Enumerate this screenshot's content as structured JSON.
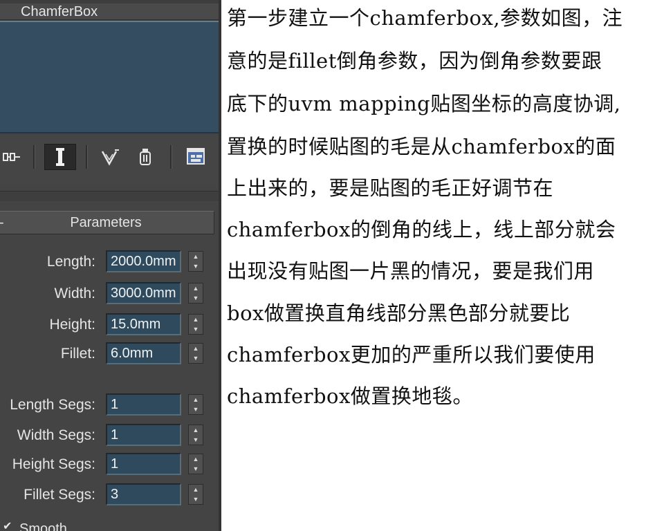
{
  "panel": {
    "object_name": "ChamferBox",
    "toolbar": {
      "icons": [
        "pin-stack-icon",
        "show-end-result-icon",
        "make-unique-icon",
        "remove-modifier-icon",
        "configure-modifier-sets-icon"
      ]
    },
    "rollout": {
      "toggle": "-",
      "title": "Parameters"
    },
    "params": [
      {
        "label": "Length:",
        "value": "2000.0mm"
      },
      {
        "label": "Width:",
        "value": "3000.0mm"
      },
      {
        "label": "Height:",
        "value": "15.0mm"
      },
      {
        "label": "Fillet:",
        "value": "6.0mm"
      }
    ],
    "segs": [
      {
        "label": "Length Segs:",
        "value": "1"
      },
      {
        "label": "Width Segs:",
        "value": "1"
      },
      {
        "label": "Height Segs:",
        "value": "1"
      },
      {
        "label": "Fillet Segs:",
        "value": "3"
      }
    ],
    "smooth": {
      "label": "Smooth",
      "checked": true
    }
  },
  "article": {
    "lines": [
      "第一步建立一个chamferbox,参数如图，注",
      "意的是fillet倒角参数，因为倒角参数要跟",
      "底下的uvm mapping贴图坐标的高度协调,",
      "置换的时候贴图的毛是从chamferbox的面",
      "上出来的，要是贴图的毛正好调节在",
      "chamferbox的倒角的线上，线上部分就会",
      "出现没有贴图一片黑的情况，要是我们用",
      "box做置换直角线部分黑色部分就要比",
      "chamferbox更加的严重所以我们要使用",
      "chamferbox做置换地毯。"
    ]
  },
  "colors": {
    "panel_bg": "#444444",
    "viewport": "#344d60",
    "field_bg": "#2f4a5c",
    "text_light": "#e5e5e5",
    "article_text": "#111111"
  }
}
